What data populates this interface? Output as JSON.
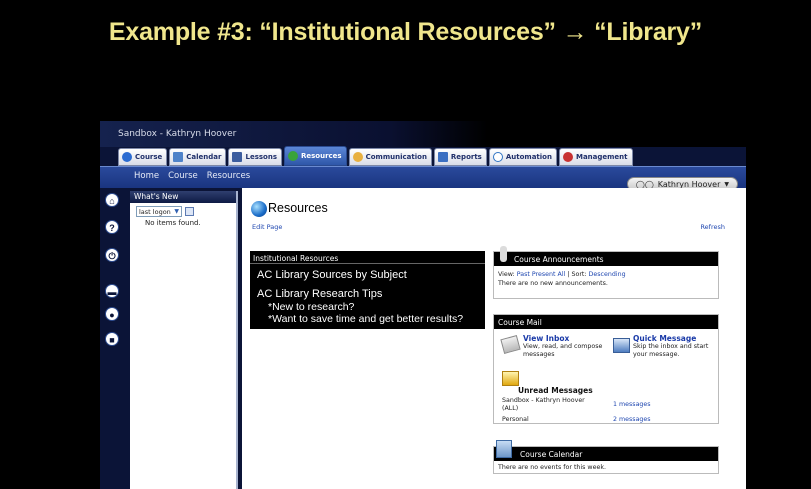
{
  "slide": {
    "title": "Example #3: “Institutional Resources” → “Library”"
  },
  "app": {
    "site_name": "Sandbox - Kathryn Hoover",
    "tabs": [
      {
        "label": "Course",
        "icon": "info-icon",
        "color": "#2a6bd1"
      },
      {
        "label": "Calendar",
        "icon": "calendar-icon",
        "color": "#4f83c9"
      },
      {
        "label": "Lessons",
        "icon": "lessons-icon",
        "color": "#3c5d9e"
      },
      {
        "label": "Resources",
        "icon": "resources-icon",
        "color": "#39a339",
        "active": true
      },
      {
        "label": "Communication",
        "icon": "communication-icon",
        "color": "#e8b040"
      },
      {
        "label": "Reports",
        "icon": "reports-icon",
        "color": "#3b6fc2"
      },
      {
        "label": "Automation",
        "icon": "automation-icon",
        "color": "#2f74c4"
      },
      {
        "label": "Management",
        "icon": "management-icon",
        "color": "#c83232"
      }
    ],
    "breadcrumb": [
      "Home",
      "Course",
      "Resources"
    ],
    "user_name": "Kathryn Hoover"
  },
  "whats_new": {
    "title": "What's New",
    "filter_value": "last logon",
    "empty_text": "No items found."
  },
  "main": {
    "title": "Resources",
    "edit_page": "Edit Page",
    "refresh": "Refresh"
  },
  "institutional_resources": {
    "title": "Institutional Resources",
    "links": [
      "AC Library Sources by Subject",
      "AC Library Research Tips"
    ],
    "tips": [
      "*New to research?",
      "*Want to save time and get better results?"
    ]
  },
  "announcements": {
    "title": "Course Announcements",
    "view_label": "View:",
    "past": "Past",
    "present": "Present",
    "all": "All",
    "sort_label": "| Sort:",
    "sort_value": "Descending",
    "empty_text": "There are no new announcements."
  },
  "course_mail": {
    "title": "Course Mail",
    "view_inbox_title": "View Inbox",
    "view_inbox_desc": "View, read, and compose messages",
    "quick_message_title": "Quick Message",
    "quick_message_desc": "Skip the inbox and start your message.",
    "unread_title": "Unread Messages",
    "rows": [
      {
        "label": "Sandbox - Kathryn Hoover (ALL)",
        "count": "1 messages"
      },
      {
        "label": "Personal",
        "count": "2 messages"
      }
    ]
  },
  "course_calendar": {
    "title": "Course Calendar",
    "empty_text": "There are no events for this week."
  }
}
